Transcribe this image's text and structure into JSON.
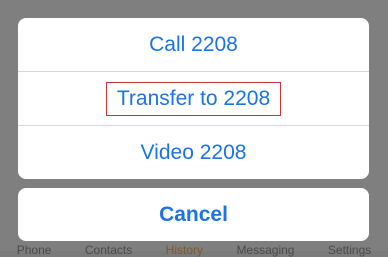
{
  "actions": [
    {
      "label": "Call 2208"
    },
    {
      "label": "Transfer to 2208"
    },
    {
      "label": "Video 2208"
    }
  ],
  "cancel_label": "Cancel",
  "tabbar": [
    {
      "label": "Phone"
    },
    {
      "label": "Contacts"
    },
    {
      "label": "History"
    },
    {
      "label": "Messaging"
    },
    {
      "label": "Settings"
    }
  ],
  "colors": {
    "accent": "#1a73e8",
    "highlight_border": "#c7343a",
    "overlay": "#7f7f7f"
  }
}
